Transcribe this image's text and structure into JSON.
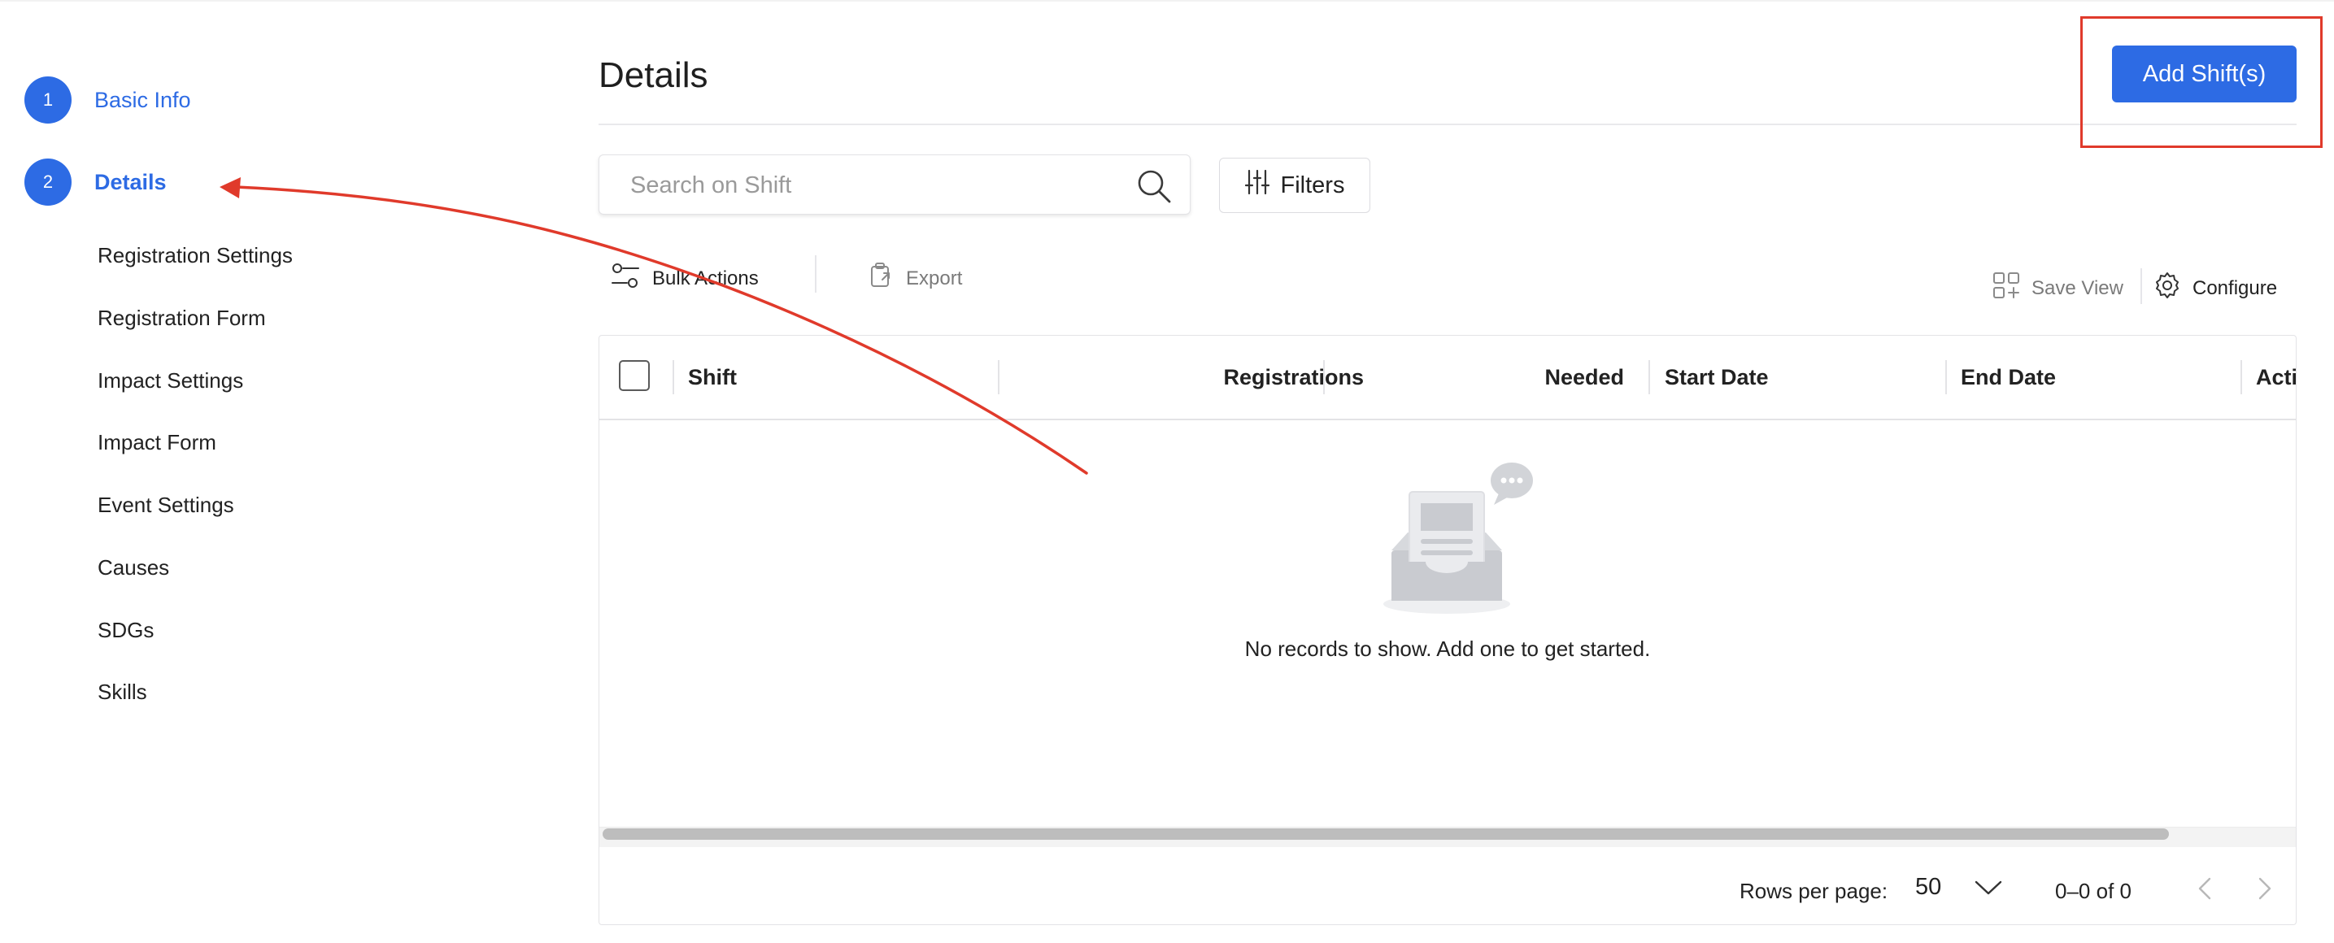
{
  "stepper": {
    "steps": [
      {
        "number": "1",
        "label": "Basic Info"
      },
      {
        "number": "2",
        "label": "Details"
      }
    ],
    "sub_items": [
      "Registration Settings",
      "Registration Form",
      "Impact Settings",
      "Impact Form",
      "Event Settings",
      "Causes",
      "SDGs",
      "Skills"
    ]
  },
  "main": {
    "title": "Details",
    "add_button": "Add Shift(s)",
    "search": {
      "placeholder": "Search on Shift",
      "value": ""
    },
    "filters_label": "Filters",
    "toolbar": {
      "bulk_actions": "Bulk Actions",
      "export": "Export",
      "save_view": "Save View",
      "configure": "Configure"
    },
    "table": {
      "columns": [
        "Shift",
        "Registrations",
        "Needed",
        "Start Date",
        "End Date",
        "Acti"
      ],
      "empty_message": "No records to show. Add one to get started."
    },
    "footer": {
      "rows_per_page_label": "Rows per page:",
      "rows_per_page_value": "50",
      "range": "0–0 of 0"
    }
  },
  "colors": {
    "accent": "#2d6be4",
    "annotation": "#e03a2b",
    "text": "#1f1f1f",
    "border": "#e3e3e6"
  },
  "icons": [
    "search-icon",
    "filters-icon",
    "bulk-actions-icon",
    "export-icon",
    "save-view-icon",
    "gear-icon",
    "chevron-down-icon",
    "chevron-left-icon",
    "chevron-right-icon"
  ]
}
